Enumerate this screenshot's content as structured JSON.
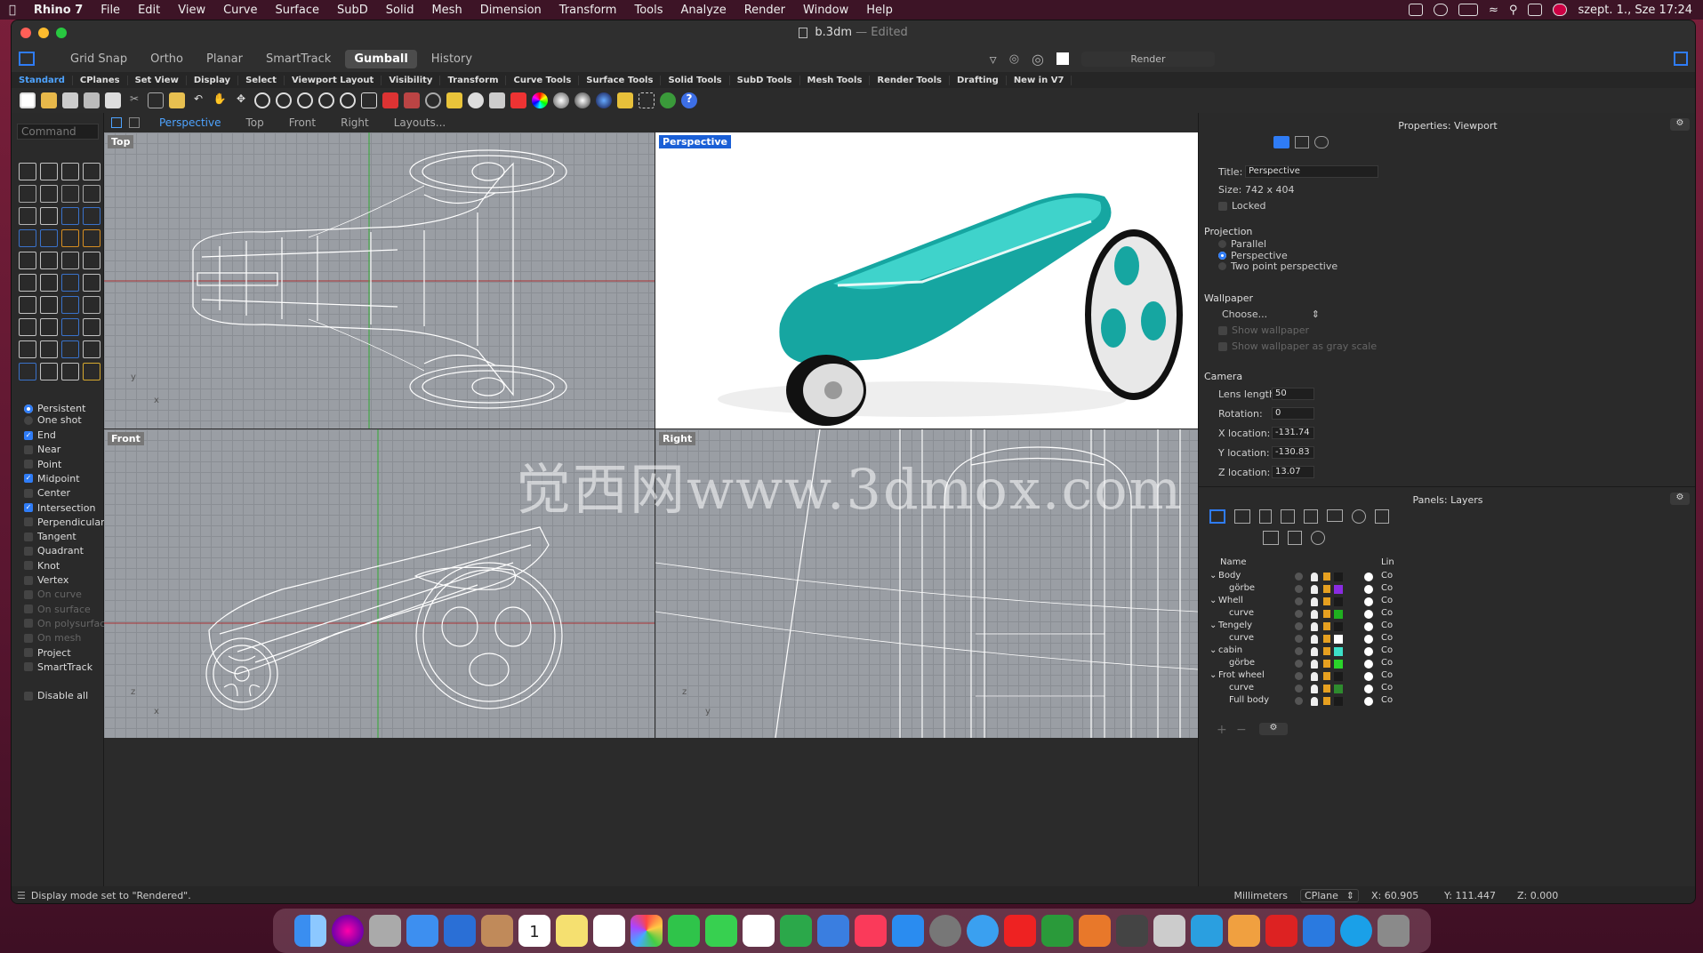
{
  "menubar": {
    "app": "Rhino 7",
    "items": [
      "File",
      "Edit",
      "View",
      "Curve",
      "Surface",
      "SubD",
      "Solid",
      "Mesh",
      "Dimension",
      "Transform",
      "Tools",
      "Analyze",
      "Render",
      "Window",
      "Help"
    ],
    "clock": "szept. 1., Sze  17:24"
  },
  "window": {
    "filename": "b.3dm",
    "state": "Edited",
    "render_label": "Render"
  },
  "modes": [
    "Grid Snap",
    "Ortho",
    "Planar",
    "SmartTrack",
    "Gumball",
    "History"
  ],
  "active_mode": "Gumball",
  "toolbar_tabs": [
    "Standard",
    "CPlanes",
    "Set View",
    "Display",
    "Select",
    "Viewport Layout",
    "Visibility",
    "Transform",
    "Curve Tools",
    "Surface Tools",
    "Solid Tools",
    "SubD Tools",
    "Mesh Tools",
    "Render Tools",
    "Drafting",
    "New in V7"
  ],
  "active_toolbar_tab": "Standard",
  "command_placeholder": "Command",
  "osnap": {
    "persistent_label": "Persistent",
    "oneshot_label": "One shot",
    "items": [
      {
        "label": "End",
        "checked": true,
        "dim": false
      },
      {
        "label": "Near",
        "checked": false,
        "dim": false
      },
      {
        "label": "Point",
        "checked": false,
        "dim": false
      },
      {
        "label": "Midpoint",
        "checked": true,
        "dim": false
      },
      {
        "label": "Center",
        "checked": false,
        "dim": false
      },
      {
        "label": "Intersection",
        "checked": true,
        "dim": false
      },
      {
        "label": "Perpendicular",
        "checked": false,
        "dim": false
      },
      {
        "label": "Tangent",
        "checked": false,
        "dim": false
      },
      {
        "label": "Quadrant",
        "checked": false,
        "dim": false
      },
      {
        "label": "Knot",
        "checked": false,
        "dim": false
      },
      {
        "label": "Vertex",
        "checked": false,
        "dim": false
      },
      {
        "label": "On curve",
        "checked": false,
        "dim": true
      },
      {
        "label": "On surface",
        "checked": false,
        "dim": true
      },
      {
        "label": "On polysurface",
        "checked": false,
        "dim": true
      },
      {
        "label": "On mesh",
        "checked": false,
        "dim": true
      },
      {
        "label": "Project",
        "checked": false,
        "dim": false
      },
      {
        "label": "SmartTrack",
        "checked": false,
        "dim": false
      }
    ],
    "disable_all": "Disable all"
  },
  "viewport_tabs": [
    "Perspective",
    "Top",
    "Front",
    "Right",
    "Layouts..."
  ],
  "active_viewport_tab": "Perspective",
  "viewports": {
    "top": "Top",
    "perspective": "Perspective",
    "front": "Front",
    "right": "Right"
  },
  "axes": {
    "x": "x",
    "y": "y",
    "z": "z"
  },
  "watermark": "觉西网www.3dmox.com",
  "properties": {
    "header": "Properties: Viewport",
    "title_label": "Title:",
    "title_value": "Perspective",
    "size_label": "Size:",
    "size_value": "742 x 404",
    "locked_label": "Locked",
    "projection_header": "Projection",
    "projection_options": [
      {
        "label": "Parallel",
        "selected": false
      },
      {
        "label": "Perspective",
        "selected": true
      },
      {
        "label": "Two point perspective",
        "selected": false
      }
    ],
    "wallpaper_header": "Wallpaper",
    "wallpaper_choose": "Choose...",
    "show_wallpaper": "Show wallpaper",
    "show_wallpaper_gray": "Show wallpaper as gray scale",
    "camera_header": "Camera",
    "camera": [
      {
        "label": "Lens length:",
        "value": "50"
      },
      {
        "label": "Rotation:",
        "value": "0"
      },
      {
        "label": "X location:",
        "value": "-131.74"
      },
      {
        "label": "Y location:",
        "value": "-130.83"
      },
      {
        "label": "Z location:",
        "value": "13.07"
      }
    ]
  },
  "layers": {
    "header": "Panels: Layers",
    "col_name": "Name",
    "col_lin": "Lin",
    "rows": [
      {
        "name": "Body",
        "parent": true,
        "color": "#1a1a1a",
        "lin": "Co"
      },
      {
        "name": "görbe",
        "parent": false,
        "color": "#8a2be2",
        "lin": "Co"
      },
      {
        "name": "Whell",
        "parent": true,
        "color": "#1a1a1a",
        "lin": "Co"
      },
      {
        "name": "curve",
        "parent": false,
        "color": "#1fb01f",
        "lin": "Co"
      },
      {
        "name": "Tengely",
        "parent": true,
        "color": "#1a1a1a",
        "lin": "Co"
      },
      {
        "name": "curve",
        "parent": false,
        "color": "#ffffff",
        "lin": "Co"
      },
      {
        "name": "cabin",
        "parent": true,
        "color": "#3de0c8",
        "lin": "Co"
      },
      {
        "name": "görbe",
        "parent": false,
        "color": "#2ad42a",
        "lin": "Co"
      },
      {
        "name": "Frot wheel",
        "parent": true,
        "color": "#1a1a1a",
        "lin": "Co"
      },
      {
        "name": "curve",
        "parent": false,
        "color": "#2e8b2e",
        "lin": "Co"
      },
      {
        "name": "Full body",
        "parent": false,
        "color": "#1a1a1a",
        "lin": "Co"
      }
    ]
  },
  "status": {
    "message": "Display mode set to \"Rendered\".",
    "units": "Millimeters",
    "cplane": "CPlane",
    "x": "X: 60.905",
    "y": "Y: 111.447",
    "z": "Z: 0.000"
  },
  "dock_calendar_day": "1",
  "colors": {
    "accent": "#2f7cf6",
    "teal_body": "#1fb5b0",
    "viewport_grid": "#9a9ea4"
  }
}
